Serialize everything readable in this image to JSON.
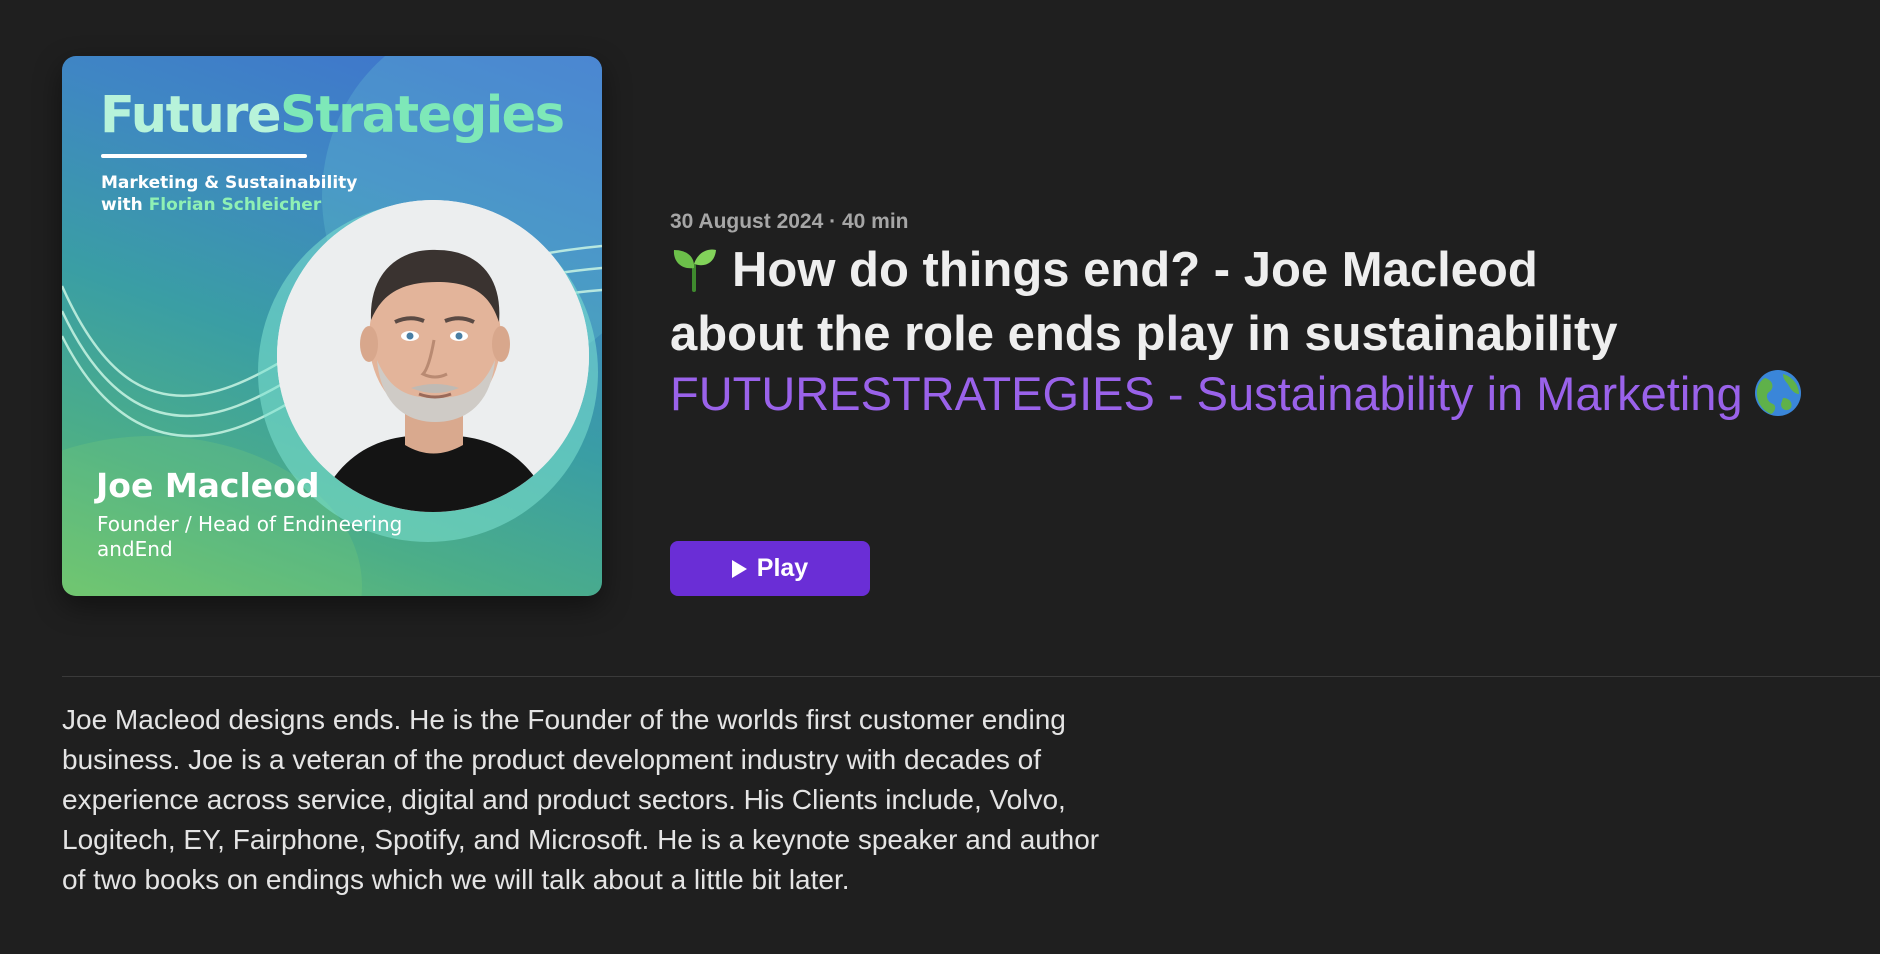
{
  "artwork": {
    "brand_part1": "Future",
    "brand_part2": "Strategies",
    "tagline_line1": "Marketing & Sustainability",
    "tagline_with": "with",
    "tagline_host": "Florian Schleicher",
    "guest_name": "Joe Macleod",
    "guest_role_line1": "Founder / Head of Endineering",
    "guest_role_line2": "andEnd",
    "colors": {
      "gradient_top": "#3f6fd0",
      "gradient_bottom": "#6cc26e",
      "brand_accent": "#7ee8b8"
    }
  },
  "episode": {
    "date": "30 August 2024",
    "separator": "·",
    "duration": "40 min",
    "title_icon": "seedling-icon",
    "title_line1": "How do things end? - Joe Macleod",
    "title_line2": "about the role ends play in sustainability",
    "podcast_name": "FUTURESTRATEGIES - Sustainability in Marketing",
    "podcast_icon": "globe-icon",
    "play_label": "Play",
    "description": "Joe Macleod designs ends. He is the Founder of the worlds first customer ending business. Joe is a veteran of the product development industry with decades of experience across service, digital and product sectors. His Clients include, Volvo, Logitech, EY, Fairphone, Spotify, and Microsoft. He is a keynote speaker and author of two books on endings which we will talk about a little bit later."
  },
  "colors": {
    "background": "#1f1f1f",
    "accent": "#6a2ed6",
    "link": "#9a62ea",
    "meta_text": "#a6a6a6"
  }
}
